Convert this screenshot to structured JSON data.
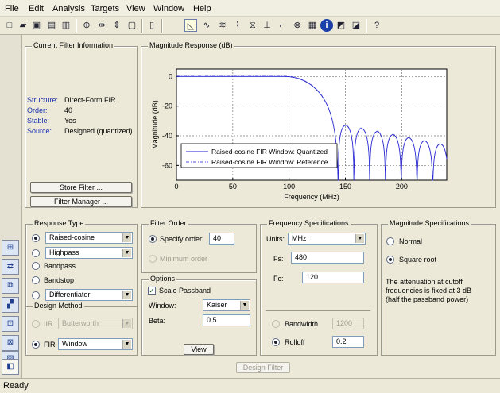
{
  "menu": [
    "File",
    "Edit",
    "Analysis",
    "Targets",
    "View",
    "Window",
    "Help"
  ],
  "toolbar_icons": [
    "new-icon",
    "open-icon",
    "save-icon",
    "print-icon",
    "print-preview-icon",
    "zoom-in-icon",
    "zoom-x-icon",
    "zoom-y-icon",
    "full-view-icon",
    "sidebar-icon",
    "magnitude-response-icon",
    "phase-response-icon",
    "magnitude-phase-icon",
    "group-delay-icon",
    "phase-delay-icon",
    "impulse-response-icon",
    "step-response-icon",
    "pole-zero-icon",
    "coefficients-icon",
    "info-icon",
    "magnitude-estimate-icon",
    "round-off-noise-icon",
    "whats-this-icon"
  ],
  "filter_info": {
    "title": "Current Filter Information",
    "rows": [
      {
        "label": "Structure:",
        "value": "Direct-Form FIR"
      },
      {
        "label": "Order:",
        "value": "40"
      },
      {
        "label": "Stable:",
        "value": "Yes"
      },
      {
        "label": "Source:",
        "value": "Designed (quantized)"
      }
    ],
    "store_button": "Store Filter ...",
    "manager_button": "Filter Manager ..."
  },
  "plot": {
    "title": "Magnitude Response (dB)",
    "colors": {
      "quantized": "#1f1fd0",
      "reference": "#5050e0"
    }
  },
  "chart_data": {
    "type": "line",
    "title": "",
    "xlabel": "Frequency (MHz)",
    "ylabel": "Magnitude (dB)",
    "xlim": [
      0,
      240
    ],
    "ylim": [
      -70,
      5
    ],
    "xticks": [
      "0",
      "50",
      "100",
      "150",
      "200"
    ],
    "xtick_values": [
      0,
      50,
      100,
      150,
      200
    ],
    "yticks": [
      "0",
      "-20",
      "-40",
      "-60"
    ],
    "ytick_values": [
      0,
      -20,
      -40,
      -60
    ],
    "grid": true,
    "legend_placement": "bottom-left",
    "series": [
      {
        "name": "Raised-cosine FIR Window: Quantized",
        "style": "solid"
      },
      {
        "name": "Raised-cosine FIR Window: Reference",
        "style": "dashdot"
      }
    ]
  },
  "response_type": {
    "title": "Response Type",
    "options": [
      {
        "label": "Raised-cosine",
        "selected": true,
        "has_select": true
      },
      {
        "label": "Highpass",
        "selected": false,
        "has_select": true
      },
      {
        "label": "Bandpass",
        "selected": false,
        "has_select": false
      },
      {
        "label": "Bandstop",
        "selected": false,
        "has_select": false
      },
      {
        "label": "Differentiator",
        "selected": false,
        "has_select": true
      }
    ]
  },
  "design_method": {
    "title": "Design Method",
    "iir_label": "IIR",
    "iir_value": "Butterworth",
    "fir_label": "FIR",
    "fir_value": "Window"
  },
  "filter_order": {
    "title": "Filter Order",
    "specify_label": "Specify order:",
    "specify_value": "40",
    "minimum_label": "Minimum order"
  },
  "options": {
    "title": "Options",
    "scale_passband": "Scale Passband",
    "window_label": "Window:",
    "window_value": "Kaiser",
    "beta_label": "Beta:",
    "beta_value": "0.5",
    "view_button": "View"
  },
  "freq_specs": {
    "title": "Frequency Specifications",
    "units_label": "Units:",
    "units_value": "MHz",
    "fs_label": "Fs:",
    "fs_value": "480",
    "fc_label": "Fc:",
    "fc_value": "120",
    "bandwidth_label": "Bandwidth",
    "bandwidth_value": "1200",
    "rolloff_label": "Rolloff",
    "rolloff_value": "0.2"
  },
  "mag_specs": {
    "title": "Magnitude Specifications",
    "normal_label": "Normal",
    "sqrt_label": "Square root",
    "note": "The attenuation at cutoff frequencies is fixed at 3 dB (half the passband power)"
  },
  "design_button": "Design Filter",
  "status": "Ready",
  "side_icons": [
    "sidebar-design-icon-1",
    "sidebar-design-icon-2",
    "sidebar-design-icon-3",
    "sidebar-design-icon-4",
    "sidebar-design-icon-5",
    "sidebar-design-icon-6",
    "sidebar-design-icon-7",
    "sidebar-design-icon-8"
  ]
}
